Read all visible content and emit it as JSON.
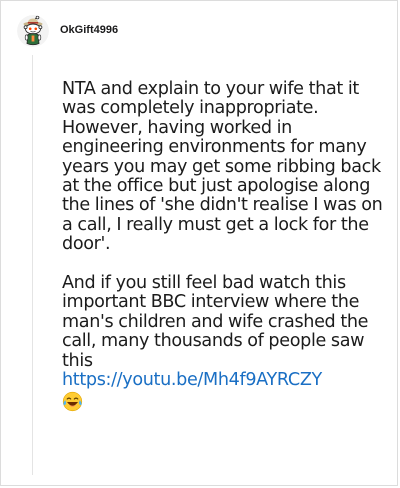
{
  "post": {
    "username": "OkGift4996",
    "paragraphs": [
      "NTA and explain to your wife that it was completely inappropriate. However, having worked in engineering environments for many years you may get some ribbing back at the office but just apologise along the lines of 'she didn't realise I was on a call, I really must get a lock for the door'.",
      "And if you still feel bad watch this important BBC interview where the man's children and wife crashed the call, many thousands of people saw this"
    ],
    "link_text": "https://youtu.be/Mh4f9AYRCZY",
    "emoji": "laughing-with-tears-emoji"
  },
  "colors": {
    "text": "#1c1c1c",
    "link": "#1a6fc4",
    "border": "#dcdcdc",
    "thread_line": "#e4e4e4"
  }
}
